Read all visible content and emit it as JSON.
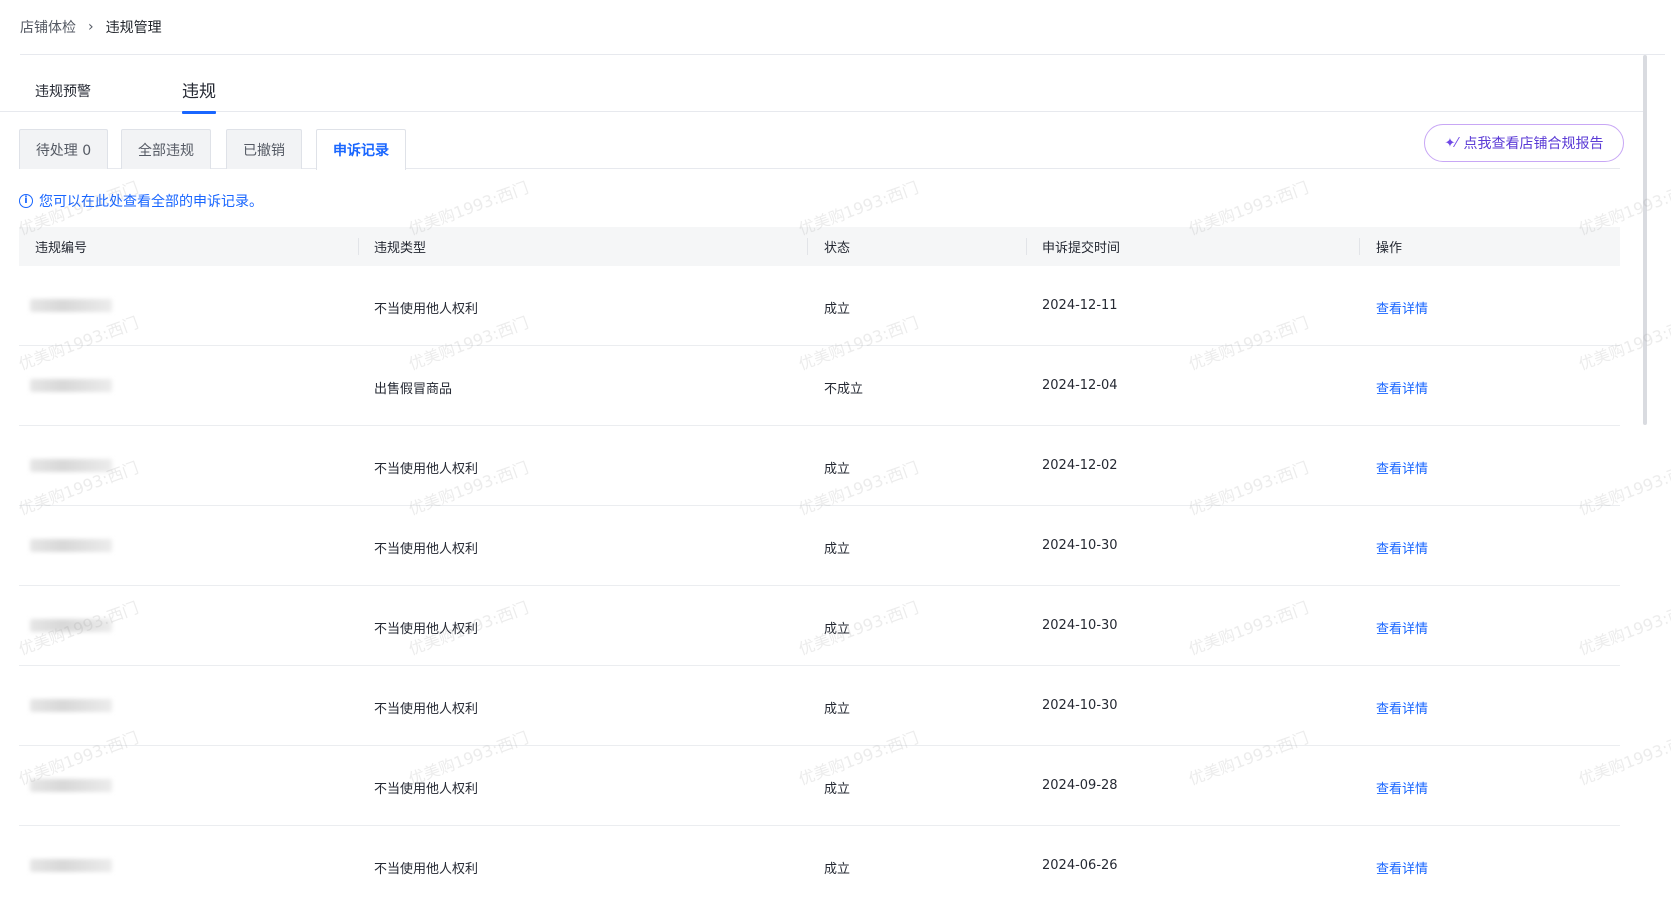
{
  "breadcrumb": {
    "parent": "店铺体检",
    "separator": "›",
    "current": "违规管理"
  },
  "main_tabs": [
    {
      "label": "违规预警",
      "active": false
    },
    {
      "label": "违规",
      "active": true
    }
  ],
  "sub_tabs": [
    {
      "label": "待处理 0",
      "active": false
    },
    {
      "label": "全部违规",
      "active": false
    },
    {
      "label": "已撤销",
      "active": false
    },
    {
      "label": "申诉记录",
      "active": true
    }
  ],
  "report_button": {
    "label": "点我查看店铺合规报告",
    "icon": "sparkle-wand-icon"
  },
  "notice": {
    "icon": "info-icon",
    "text": "您可以在此处查看全部的申诉记录。"
  },
  "table": {
    "headers": [
      "违规编号",
      "违规类型",
      "状态",
      "申诉提交时间",
      "操作"
    ],
    "rows": [
      {
        "type": "不当使用他人权利",
        "status": "成立",
        "time": "2024-12-11",
        "action": "查看详情"
      },
      {
        "type": "出售假冒商品",
        "status": "不成立",
        "time": "2024-12-04",
        "action": "查看详情"
      },
      {
        "type": "不当使用他人权利",
        "status": "成立",
        "time": "2024-12-02",
        "action": "查看详情"
      },
      {
        "type": "不当使用他人权利",
        "status": "成立",
        "time": "2024-10-30",
        "action": "查看详情"
      },
      {
        "type": "不当使用他人权利",
        "status": "成立",
        "time": "2024-10-30",
        "action": "查看详情"
      },
      {
        "type": "不当使用他人权利",
        "status": "成立",
        "time": "2024-10-30",
        "action": "查看详情"
      },
      {
        "type": "不当使用他人权利",
        "status": "成立",
        "time": "2024-09-28",
        "action": "查看详情"
      },
      {
        "type": "不当使用他人权利",
        "status": "成立",
        "time": "2024-06-26",
        "action": "查看详情"
      }
    ]
  },
  "watermark_text": "优美购1993:西门",
  "colors": {
    "accent": "#1966ff",
    "report_border": "#c8a7f5",
    "report_text": "#5b3bd6"
  }
}
